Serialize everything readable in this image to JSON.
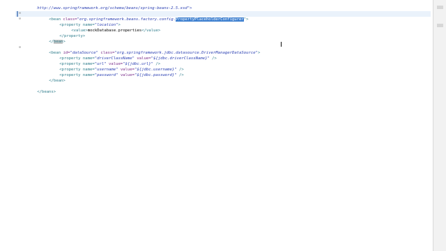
{
  "editor": {
    "line1": "http://www.springframework.org/schema/beans/spring-beans-2.5.xsd\">",
    "bean1": {
      "open_tag": "<bean",
      "class_attr": "class=",
      "class_value_prefix": "\"org.springframework.beans.factory.config.",
      "class_value_selected": "PropertyPlaceholderConfigurer",
      "class_value_suffix": "\">",
      "property_open": "<property name=",
      "property_name": "\"location\"",
      "property_close": ">",
      "value_open": "<value>",
      "value_text": "mockDatabase.properties",
      "value_close": "</value>",
      "property_end": "</property>",
      "bean_end_prefix": "</",
      "bean_end_word": "bean",
      "bean_end_suffix": ">"
    },
    "bean2": {
      "open_tag": "<bean",
      "id_attr": "id=",
      "id_value": "\"dataSource\"",
      "class_attr": "class=",
      "class_value": "\"org.springframework.jdbc.datasource.DriverManagerDataSource\"",
      "tag_close": ">",
      "properties": [
        {
          "name_label": "<property name=",
          "name": "\"driverClassName\"",
          "value_label": "value=",
          "value": "\"${jdbc.driverClassName}\"",
          "close": " />"
        },
        {
          "name_label": "<property name=",
          "name": "\"url\"",
          "value_label": "value=",
          "value": "\"${jdbc.url}\"",
          "close": " />"
        },
        {
          "name_label": "<property name=",
          "name": "\"username\"",
          "value_label": "value=",
          "value": "\"${jdbc.username}\"",
          "close": " />"
        },
        {
          "name_label": "<property name=",
          "name": "\"password\"",
          "value_label": "value=",
          "value": "\"${jdbc.password}\"",
          "close": " />"
        }
      ],
      "bean_end": "</bean>"
    },
    "beans_end": "</beans>"
  },
  "icons": {
    "fold_minus": "fold-collapse-icon",
    "cursor": "text-cursor-icon"
  }
}
